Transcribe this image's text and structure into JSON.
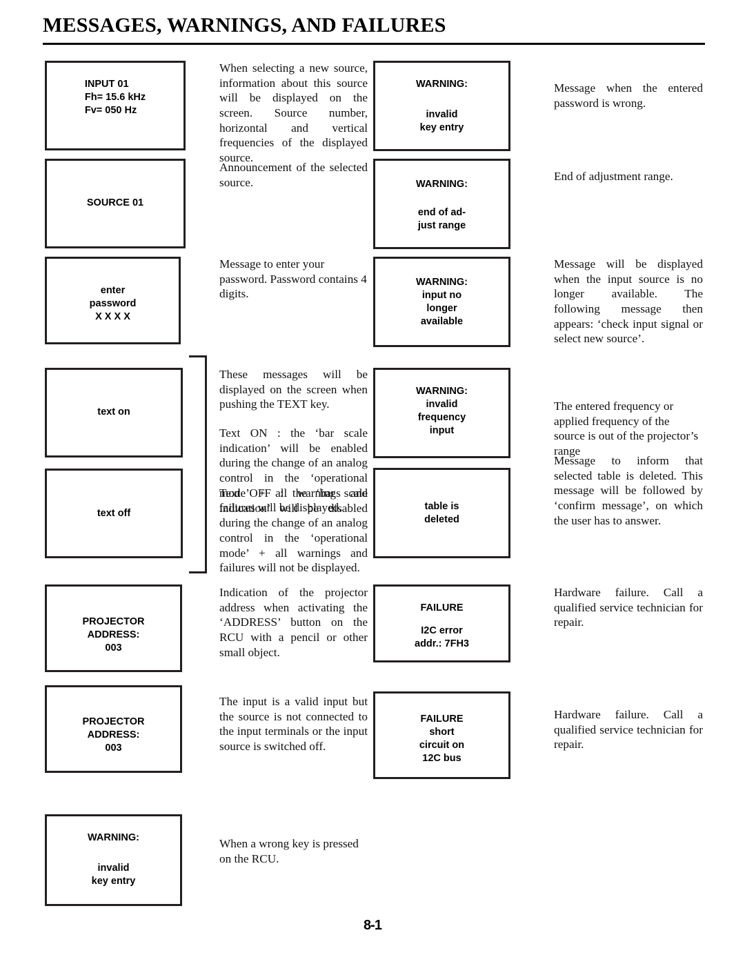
{
  "page": {
    "title": "MESSAGES, WARNINGS, AND FAILURES",
    "page_number": "8-1"
  },
  "left_boxes": [
    {
      "name": "input-info",
      "lines": [
        "INPUT 01",
        "Fh= 15.6 kHz",
        "Fv= 050 Hz"
      ]
    },
    {
      "name": "source-announcement",
      "lines": [
        "SOURCE 01"
      ]
    },
    {
      "name": "enter-password",
      "lines": [
        "enter",
        "password",
        "X X X X"
      ]
    },
    {
      "name": "text-on",
      "lines": [
        "text on"
      ]
    },
    {
      "name": "text-off",
      "lines": [
        "text off"
      ]
    },
    {
      "name": "projector-address-1",
      "lines": [
        "PROJECTOR",
        "ADDRESS:",
        "003"
      ]
    },
    {
      "name": "projector-address-2",
      "lines": [
        "PROJECTOR",
        "ADDRESS:",
        "003"
      ]
    },
    {
      "name": "warning-invalid-key-entry",
      "heading": "WARNING:",
      "lines": [
        "invalid",
        "key entry"
      ]
    }
  ],
  "right_boxes": [
    {
      "name": "warning-invalid-key-entry",
      "heading": "WARNING:",
      "lines": [
        "invalid",
        "key entry"
      ]
    },
    {
      "name": "warning-end-of-adjust-range",
      "heading": "WARNING:",
      "lines": [
        "end of ad-",
        "just range"
      ]
    },
    {
      "name": "warning-input-no-longer-available",
      "lines": [
        "WARNING:",
        "input no",
        "longer",
        "available"
      ]
    },
    {
      "name": "warning-invalid-frequency-input",
      "lines": [
        "WARNING:",
        "invalid",
        "frequency",
        "input"
      ]
    },
    {
      "name": "message-table-is-deleted",
      "lines": [
        "table is",
        "deleted"
      ]
    },
    {
      "name": "failure-i2c-error",
      "heading": "FAILURE",
      "lines": [
        "I2C  error",
        "addr.: 7FH3"
      ]
    },
    {
      "name": "failure-short-circuit",
      "lines": [
        "FAILURE",
        "short",
        "circuit on",
        "12C bus"
      ]
    }
  ],
  "middle_paragraphs": {
    "source_info": "When selecting a new source, information about this source will be displayed on the screen. Source number, horizontal and vertical frequencies of the displayed source.",
    "announcement": "Announcement of the selected source.",
    "password": "Message to enter your password. Password contains 4 digits.",
    "text_key_intro": "These messages will be displayed on the screen when pushing the TEXT key.",
    "text_on": "Text ON : the ‘bar scale indication’ will be enabled during the change of an analog control in the ‘operational mode’ + all warnings and failures will be displayed.",
    "text_off": "Text OFF : the ‘bar scale indication’ will be disabled during the change of an analog control in the ‘operational mode’ + all warnings and failures will not be displayed.",
    "projector_address": "Indication of the projector address when activating the ‘ADDRESS’ button on the RCU with a pencil or other small object.",
    "input_not_connected": "The input is a valid input but the source is not connected to the input terminals or the input source is switched off.",
    "wrong_key": "When a wrong key is pressed on the RCU."
  },
  "right_paragraphs": {
    "password_wrong": "Message when the entered password is wrong.",
    "end_of_range": "End of adjustment range.",
    "input_unavailable": "Message will be displayed when the input source is no longer available. The following message then appears: ‘check input signal or select new source’.",
    "frequency_out_of_range": "The entered frequency or applied frequency of the source is out of the projector’s range",
    "table_deleted": "Message to inform that selected table is deleted. This message will be followed by ‘confirm message’, on which the user has to answer.",
    "hardware_failure_1": "Hardware failure. Call a qualified service technician for repair.",
    "hardware_failure_2": "Hardware failure. Call a qualified service technician for repair."
  }
}
